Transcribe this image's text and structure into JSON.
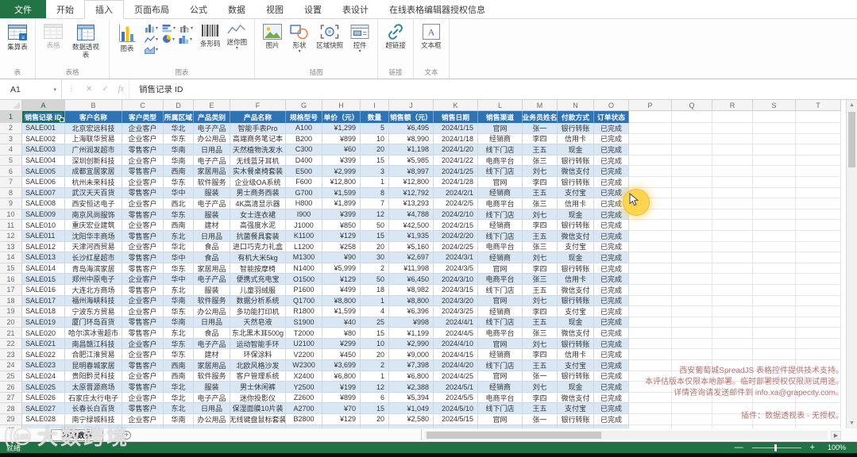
{
  "window": {
    "file_tab": "文件",
    "tabs": [
      "开始",
      "插入",
      "页面布局",
      "公式",
      "数据",
      "视图",
      "设置",
      "表设计",
      "在线表格编辑器授权信息"
    ],
    "active_tab": "插入"
  },
  "ribbon": {
    "groups": [
      {
        "label": "表",
        "items": [
          {
            "label": "集算表",
            "icon": "tablesheet"
          }
        ]
      },
      {
        "label": "表格",
        "items": [
          {
            "label": "表格",
            "icon": "table",
            "disabled": true
          },
          {
            "label": "数据透视表",
            "icon": "pivot"
          }
        ]
      },
      {
        "label": "图表",
        "items": [
          {
            "label": "图表",
            "icon": "chart"
          }
        ],
        "mini": [
          [
            "minicol",
            "minihbar",
            "minicombo"
          ],
          [
            "miniline",
            "minipie",
            "minihist"
          ],
          [
            "miniarea"
          ]
        ],
        "extra": [
          {
            "label": "条形码",
            "icon": "barcode"
          },
          {
            "label": "迷你图",
            "icon": "sparkline",
            "caret": true
          }
        ]
      },
      {
        "label": "插图",
        "items": [
          {
            "label": "图片",
            "icon": "picture"
          },
          {
            "label": "形状",
            "icon": "shapes",
            "caret": true
          },
          {
            "label": "区域快照",
            "icon": "camera"
          },
          {
            "label": "控件",
            "icon": "control",
            "caret": true
          }
        ]
      },
      {
        "label": "链接",
        "items": [
          {
            "label": "超链接",
            "icon": "hyperlink"
          }
        ]
      },
      {
        "label": "文本",
        "items": [
          {
            "label": "文本框",
            "icon": "textbox"
          }
        ]
      }
    ]
  },
  "formula_bar": {
    "name_box": "A1",
    "formula": "销售记录 ID"
  },
  "sheet": {
    "column_letters": [
      "A",
      "B",
      "C",
      "D",
      "E",
      "F",
      "G",
      "H",
      "I",
      "J",
      "K",
      "L",
      "M",
      "N",
      "O",
      "P",
      "Q",
      "R",
      "S",
      "T"
    ],
    "headers": [
      "销售记录 ID",
      "客户名称",
      "客户类型",
      "所属区域",
      "产品类别",
      "产品名称",
      "规格型号",
      "单价（元）",
      "数量",
      "销售额（元）",
      "销售日期",
      "销售渠道",
      "业务员姓名",
      "付款方式",
      "订单状态"
    ],
    "rows": [
      [
        "SALE001",
        "北京宏远科技",
        "企业客户",
        "华北",
        "电子产品",
        "智能手表Pro",
        "A100",
        "¥1,299",
        "5",
        "¥6,495",
        "2024/1/15",
        "官网",
        "张一",
        "银行转账",
        "已完成"
      ],
      [
        "SALE002",
        "上海联华贸易",
        "企业客户",
        "华东",
        "办公用品",
        "高端商务笔记本",
        "B200",
        "¥899",
        "10",
        "¥8,990",
        "2024/1/18",
        "经销商",
        "李四",
        "信用卡",
        "已完成"
      ],
      [
        "SALE003",
        "广州润发超市",
        "零售客户",
        "华南",
        "日用品",
        "天然植物洗发水",
        "C300",
        "¥60",
        "20",
        "¥1,198",
        "2024/1/20",
        "线下门店",
        "王五",
        "现金",
        "已完成"
      ],
      [
        "SALE004",
        "深圳创新科技",
        "企业客户",
        "华南",
        "电子产品",
        "无线蓝牙耳机",
        "D400",
        "¥399",
        "15",
        "¥5,985",
        "2024/1/22",
        "电商平台",
        "张三",
        "银行转账",
        "已完成"
      ],
      [
        "SALE005",
        "成都宜居家居",
        "零售客户",
        "西南",
        "家居用品",
        "实木餐桌椅套装",
        "E500",
        "¥2,999",
        "3",
        "¥8,997",
        "2024/1/25",
        "线下门店",
        "刘七",
        "微信支付",
        "已完成"
      ],
      [
        "SALE006",
        "杭州未来科技",
        "企业客户",
        "华东",
        "软件服务",
        "企业级OA系统",
        "F600",
        "¥12,800",
        "1",
        "¥12,800",
        "2024/1/28",
        "官网",
        "李四",
        "银行转账",
        "已完成"
      ],
      [
        "SALE007",
        "武汉天天百货",
        "零售客户",
        "华中",
        "服装",
        "男士商务西装",
        "G700",
        "¥1,599",
        "8",
        "¥12,792",
        "2024/2/1",
        "经销商",
        "王五",
        "支付宝",
        "已完成"
      ],
      [
        "SALE008",
        "西安恒达电子",
        "企业客户",
        "西北",
        "电子产品",
        "4K高清显示器",
        "H800",
        "¥1,899",
        "7",
        "¥13,293",
        "2024/2/5",
        "电商平台",
        "张三",
        "信用卡",
        "已完成"
      ],
      [
        "SALE009",
        "南京风尚服饰",
        "零售客户",
        "华东",
        "服装",
        "女士连衣裙",
        "I900",
        "¥399",
        "12",
        "¥4,788",
        "2024/2/10",
        "线下门店",
        "刘七",
        "现金",
        "已完成"
      ],
      [
        "SALE010",
        "重庆宏业建筑",
        "企业客户",
        "西南",
        "建材",
        "高强度水泥",
        "J1000",
        "¥850",
        "50",
        "¥42,500",
        "2024/2/15",
        "经销商",
        "李四",
        "银行转账",
        "已完成"
      ],
      [
        "SALE011",
        "沈阳华丰商场",
        "零售客户",
        "东北",
        "日用品",
        "抗菌餐具套装",
        "K1100",
        "¥129",
        "15",
        "¥1,935",
        "2024/2/20",
        "线下门店",
        "王五",
        "微信支付",
        "已完成"
      ],
      [
        "SALE012",
        "天津河西贸易",
        "企业客户",
        "华北",
        "食品",
        "进口巧克力礼盒",
        "L1200",
        "¥258",
        "20",
        "¥5,160",
        "2024/2/25",
        "电商平台",
        "张三",
        "支付宝",
        "已完成"
      ],
      [
        "SALE013",
        "长沙红星超市",
        "零售客户",
        "华中",
        "食品",
        "有机大米5kg",
        "M1300",
        "¥90",
        "30",
        "¥2,697",
        "2024/3/1",
        "经销商",
        "刘七",
        "现金",
        "已完成"
      ],
      [
        "SALE014",
        "青岛海滨家居",
        "零售客户",
        "华东",
        "家居用品",
        "智能按摩椅",
        "N1400",
        "¥5,999",
        "2",
        "¥11,998",
        "2024/3/5",
        "官网",
        "李四",
        "银行转账",
        "已完成"
      ],
      [
        "SALE015",
        "郑州中原电子",
        "企业客户",
        "华中",
        "电子产品",
        "便携式充电宝",
        "O1500",
        "¥129",
        "50",
        "¥6,450",
        "2024/3/10",
        "电商平台",
        "张三",
        "信用卡",
        "已完成"
      ],
      [
        "SALE016",
        "大连北方商场",
        "零售客户",
        "东北",
        "服装",
        "儿童羽绒服",
        "P1600",
        "¥499",
        "18",
        "¥8,982",
        "2024/3/15",
        "线下门店",
        "王五",
        "微信支付",
        "已完成"
      ],
      [
        "SALE017",
        "福州海峡科技",
        "企业客户",
        "华南",
        "软件服务",
        "数据分析系统",
        "Q1700",
        "¥8,800",
        "1",
        "¥8,800",
        "2024/3/20",
        "官网",
        "刘七",
        "银行转账",
        "已完成"
      ],
      [
        "SALE018",
        "宁波东方贸易",
        "企业客户",
        "华东",
        "办公用品",
        "多功能打印机",
        "R1800",
        "¥1,599",
        "4",
        "¥6,396",
        "2024/3/25",
        "经销商",
        "李四",
        "支付宝",
        "已完成"
      ],
      [
        "SALE019",
        "厦门环岛百货",
        "零售客户",
        "华南",
        "日用品",
        "天然皂液",
        "S1900",
        "¥40",
        "25",
        "¥998",
        "2024/4/1",
        "线下门店",
        "王五",
        "现金",
        "已完成"
      ],
      [
        "SALE020",
        "哈尔滨冰雪超市",
        "零售客户",
        "东北",
        "食品",
        "东北黑木耳500g",
        "T2000",
        "¥80",
        "15",
        "¥1,199",
        "2024/4/5",
        "电商平台",
        "张三",
        "微信支付",
        "已完成"
      ],
      [
        "SALE021",
        "南昌赣江科技",
        "企业客户",
        "华东",
        "电子产品",
        "运动智能手环",
        "U2100",
        "¥299",
        "10",
        "¥2,990",
        "2024/4/10",
        "官网",
        "刘七",
        "银行转账",
        "已完成"
      ],
      [
        "SALE022",
        "合肥江淮贸易",
        "企业客户",
        "华东",
        "建材",
        "环保涂料",
        "V2200",
        "¥450",
        "20",
        "¥9,000",
        "2024/4/15",
        "经销商",
        "李四",
        "信用卡",
        "已完成"
      ],
      [
        "SALE023",
        "昆明春城家居",
        "零售客户",
        "西南",
        "家居用品",
        "北欧风格沙发",
        "W2300",
        "¥3,699",
        "2",
        "¥7,398",
        "2024/4/20",
        "线下门店",
        "王五",
        "支付宝",
        "已完成"
      ],
      [
        "SALE024",
        "贵阳黔灵科技",
        "企业客户",
        "西南",
        "软件服务",
        "客户管理系统",
        "X2400",
        "¥6,800",
        "1",
        "¥6,800",
        "2024/4/25",
        "官网",
        "张一",
        "银行转账",
        "已完成"
      ],
      [
        "SALE025",
        "太原晋源商场",
        "零售客户",
        "华北",
        "服装",
        "男士休闲裤",
        "Y2500",
        "¥199",
        "12",
        "¥2,388",
        "2024/5/1",
        "经销商",
        "刘七",
        "现金",
        "已完成"
      ],
      [
        "SALE026",
        "石家庄太行电子",
        "企业客户",
        "华北",
        "电子产品",
        "迷你投影仪",
        "Z2600",
        "¥899",
        "6",
        "¥5,394",
        "2024/5/5",
        "电商平台",
        "李四",
        "微信支付",
        "已完成"
      ],
      [
        "SALE027",
        "长春长白百货",
        "零售客户",
        "东北",
        "日用品",
        "保湿面膜10片装",
        "A2700",
        "¥70",
        "15",
        "¥1,049",
        "2024/5/10",
        "线下门店",
        "王五",
        "支付宝",
        "已完成"
      ],
      [
        "SALE028",
        "南宁绿城科技",
        "企业客户",
        "华南",
        "办公用品",
        "无线键盘鼠标套装",
        "B2800",
        "¥129",
        "20",
        "¥2,580",
        "2024/5/15",
        "官网",
        "张一",
        "银行转账",
        "已完成"
      ]
    ]
  },
  "sheet_tabs": {
    "active": "原始数据",
    "add_label": "+"
  },
  "status_bar": {
    "ready": "就绪",
    "zoom": "100%",
    "minus": "—",
    "plus": "+"
  },
  "license_watermark": {
    "lines": [
      "西安葡萄城SpreadJS 表格控件提供技术支持。",
      "本评估版本仅限本地部署。临时部署授权仅限测试用途。",
      "详情咨询请发送邮件到 info.xa@grapecity.com。"
    ],
    "plugin_line": "插件：数据透视表 - 无授权。"
  },
  "brand_watermark": {
    "logo": "100",
    "text": "大数跨境"
  },
  "colors": {
    "excel_green": "#217346",
    "table_header_blue": "#2E74B5",
    "band_blue": "#D9E7F5",
    "selection_green": "#1E7145",
    "click_indicator_yellow": "#FFD44F",
    "license_watermark_red": "#B0655F"
  }
}
